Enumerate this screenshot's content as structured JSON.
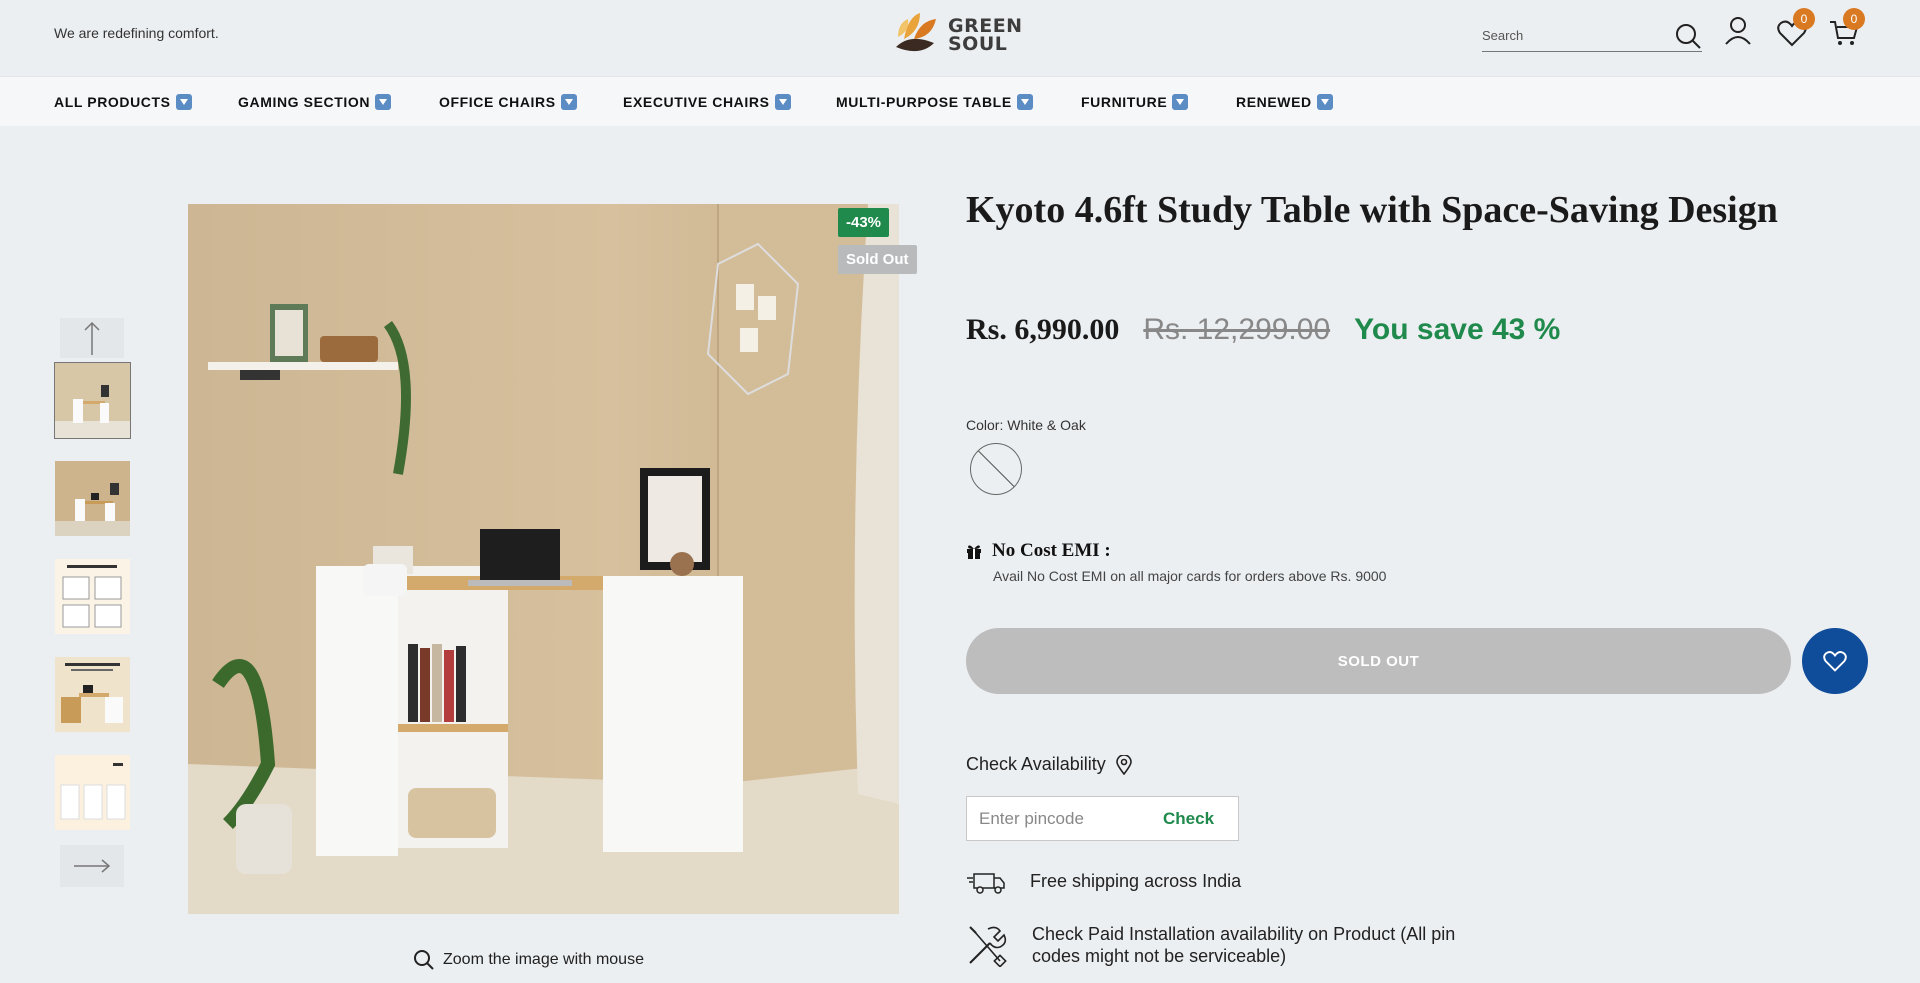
{
  "header": {
    "tagline": "We are redefining comfort.",
    "logo_line1": "GREEN",
    "logo_line2": "SOUL",
    "search_placeholder": "Search",
    "wishlist_count": "0",
    "cart_count": "0",
    "accent_color": "#d97a22"
  },
  "nav": {
    "items": [
      {
        "label": "ALL PRODUCTS"
      },
      {
        "label": "GAMING SECTION"
      },
      {
        "label": "OFFICE CHAIRS"
      },
      {
        "label": "EXECUTIVE CHAIRS"
      },
      {
        "label": "MULTI-PURPOSE TABLE"
      },
      {
        "label": "FURNITURE"
      },
      {
        "label": "RENEWED"
      }
    ]
  },
  "gallery": {
    "discount_tag": "-43%",
    "soldout_tag": "Sold Out",
    "zoom_text": "Zoom the image with mouse",
    "thumbnail_count": 5
  },
  "product": {
    "title": "Kyoto 4.6ft Study Table with Space-Saving Design",
    "price": "Rs. 6,990.00",
    "compare_price": "Rs. 12,299.00",
    "savings": "You save 43 %",
    "color_label": "Color: White & Oak",
    "emi_title": "No Cost EMI :",
    "emi_text": "Avail No Cost EMI on all major cards for orders above Rs. 9000",
    "soldout_button": "SOLD OUT",
    "availability_label": "Check Availability",
    "pincode_placeholder": "Enter pincode",
    "check_button": "Check",
    "feature_shipping": "Free shipping across India",
    "feature_installation": "Check Paid Installation availability on Product (All pin codes might not be serviceable)",
    "brand_green": "#1f8a4c",
    "wishlist_button_color": "#0f4c9a"
  }
}
